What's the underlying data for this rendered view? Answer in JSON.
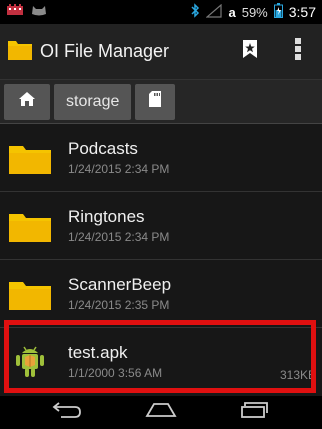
{
  "status_bar": {
    "battery_percent": "59%",
    "carrier_letter": "a",
    "time": "3:57"
  },
  "app": {
    "title": "OI File Manager"
  },
  "path": {
    "crumbs": [
      "storage"
    ]
  },
  "files": [
    {
      "name": "Podcasts",
      "date": "1/24/2015 2:34 PM",
      "size": "",
      "type": "folder"
    },
    {
      "name": "Ringtones",
      "date": "1/24/2015 2:34 PM",
      "size": "",
      "type": "folder"
    },
    {
      "name": "ScannerBeep",
      "date": "1/24/2015 2:35 PM",
      "size": "",
      "type": "folder"
    },
    {
      "name": "test.apk",
      "date": "1/1/2000 3:56 AM",
      "size": "313KE",
      "type": "apk"
    }
  ],
  "colors": {
    "folder": "#f5c400",
    "highlight": "#e01010",
    "android_green": "#9fc03a"
  },
  "icons": [
    "app-folder-icon",
    "bookmark-icon",
    "overflow-menu-icon",
    "home-icon",
    "sdcard-icon",
    "folder-icon",
    "android-icon",
    "back-icon",
    "home-nav-icon",
    "recents-icon"
  ]
}
